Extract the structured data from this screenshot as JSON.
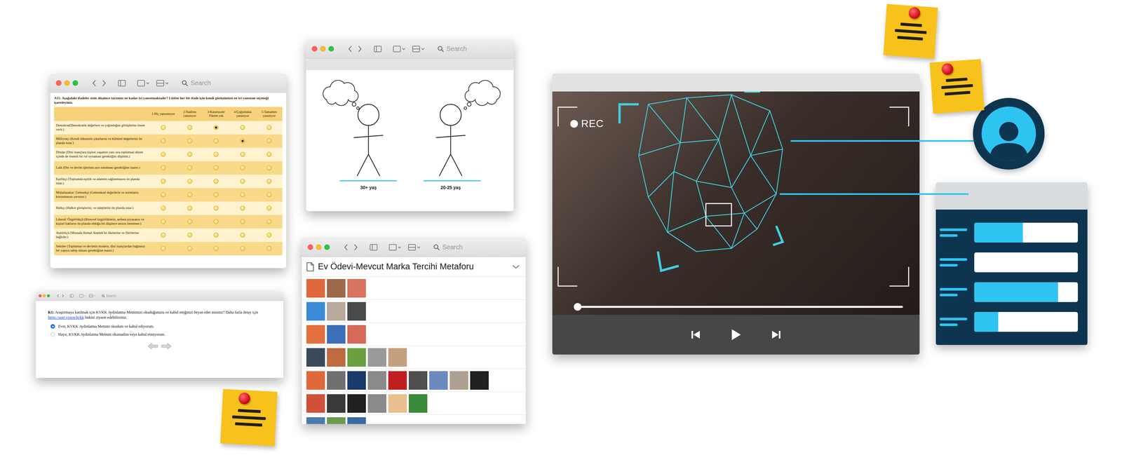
{
  "survey": {
    "search": {
      "placeholder": "Search"
    },
    "question": "A11: Aşağıdaki ifadeler sizin düşünce tarzınızı ne kadar iyi yansıtmaktadır? Lütfen her bir ifade için kendi görüşünüzü en iyi yansıtan seçeneği işaretleyiniz.",
    "columns": [
      "1-Hiç yansıtmıyor",
      "2-Nadiren yansıtıyor",
      "3-Kararsızım/ Fikrim yok",
      "4-Çoğunlukla yansıtıyor",
      "5-Tamamen yansıtıyor"
    ],
    "rows": [
      {
        "label": "Demokrat(Demokratik değerlere ve çoğunluğun görüşlerine önem verir.)",
        "choices": [
          {
            "selected": false
          },
          {
            "selected": false
          },
          {
            "selected": true
          },
          {
            "selected": false
          },
          {
            "selected": false
          }
        ]
      },
      {
        "label": "Milliyetçi (Kendi ülkesinin çıkarlarını ve kültürel değerlerini ön planda tutar.)",
        "choices": [
          {
            "selected": false
          },
          {
            "selected": false
          },
          {
            "selected": false
          },
          {
            "selected": true
          },
          {
            "selected": false
          }
        ]
      },
      {
        "label": "Dindar (Dini inançlara kişisel yaşamın yanı sıra toplumsal düzen içinde de önemli bir rol oynaması gerektiğini düşünür.)",
        "choices": [
          {
            "selected": false
          },
          {
            "selected": false
          },
          {
            "selected": false
          },
          {
            "selected": false
          },
          {
            "selected": false
          }
        ]
      },
      {
        "label": "Laik (Din ve devlet işlerinin ayrı tutulması gerektiğine inanır.)",
        "choices": [
          {
            "selected": false
          },
          {
            "selected": false
          },
          {
            "selected": false
          },
          {
            "selected": false
          },
          {
            "selected": false
          }
        ]
      },
      {
        "label": "Eşitlikçi (Toplumda eşitlik ve adaletin sağlanmasını ön planda tutar.)",
        "choices": [
          {
            "selected": false
          },
          {
            "selected": false
          },
          {
            "selected": false
          },
          {
            "selected": false
          },
          {
            "selected": false
          }
        ]
      },
      {
        "label": "Muhafazakar/ Gelenekçi (Geleneksel değerlerin ve normların korunmasını savunur.)",
        "choices": [
          {
            "selected": false
          },
          {
            "selected": false
          },
          {
            "selected": false
          },
          {
            "selected": false
          },
          {
            "selected": false
          }
        ]
      },
      {
        "label": "Halkçı (Halkın görüşlerini, ve taleplerini ön planda tutar.)",
        "choices": [
          {
            "selected": false
          },
          {
            "selected": false
          },
          {
            "selected": false
          },
          {
            "selected": false
          },
          {
            "selected": false
          }
        ]
      },
      {
        "label": "Liberal/ Özgürlükçü (Bireysel özgürlüklerin, serbest piyasanın ve kişisel hakların ön planda olduğu bir düşünce tarzını benimser.)",
        "choices": [
          {
            "selected": false
          },
          {
            "selected": false
          },
          {
            "selected": false
          },
          {
            "selected": false
          },
          {
            "selected": false
          }
        ]
      },
      {
        "label": "Atatürkçü (Mustafa Kemal Atatürk'ün ilkelerine ve fikirlerine bağlıdır.)",
        "choices": [
          {
            "selected": false
          },
          {
            "selected": false
          },
          {
            "selected": false
          },
          {
            "selected": false
          },
          {
            "selected": false
          }
        ]
      },
      {
        "label": "Seküler (Toplumun ve devletin modern, dini inançlardan bağımsız bir yapıya sahip olması gerektiğine inanır.)",
        "choices": [
          {
            "selected": false
          },
          {
            "selected": false
          },
          {
            "selected": false
          },
          {
            "selected": false
          },
          {
            "selected": false
          }
        ]
      }
    ]
  },
  "figures": {
    "search": {
      "placeholder": "Search"
    },
    "items": [
      {
        "label": "30+ yaş"
      },
      {
        "label": "20-25 yaş"
      }
    ]
  },
  "consent": {
    "search": {
      "placeholder": "Search"
    },
    "label": "K1:",
    "question": "Araştırmaya katılmak için KVKK Aydınlatma Metnimizi okuduğunuzu ve kabul ettiğinizi beyan eder misiniz? Daha fazla detay için",
    "link": "https://user.vision/kvkk",
    "question_tail": "linkini ziyaret edebilirsiniz.",
    "options": [
      {
        "label": "Evet, KVKK Aydınlatma Metnini okudum ve kabul ediyorum.",
        "selected": true
      },
      {
        "label": "Hayır, KVKK Aydınlatma Metnini okumadım veya kabul etmiyorum.",
        "selected": false
      }
    ]
  },
  "photos": {
    "search": {
      "placeholder": "Search"
    },
    "title": "Ev Ödevi-Mevcut Marka Tercihi Metaforu",
    "rows": [
      {
        "thumbnails": [
          {
            "color": "#e0683a"
          },
          {
            "color": "#9c6a4a"
          },
          {
            "color": "#d8735f"
          }
        ]
      },
      {
        "thumbnails": [
          {
            "color": "#3b8ad8"
          },
          {
            "color": "#b9a89c"
          },
          {
            "color": "#4a4a4a"
          }
        ]
      },
      {
        "thumbnails": [
          {
            "color": "#e3703c"
          },
          {
            "color": "#3d6fb8"
          },
          {
            "color": "#d56a5a"
          }
        ]
      },
      {
        "thumbnails": [
          {
            "color": "#3a4a5a"
          },
          {
            "color": "#c06a40"
          },
          {
            "color": "#6aa040"
          },
          {
            "color": "#9a9a9a"
          },
          {
            "color": "#c4a080"
          }
        ]
      },
      {
        "thumbnails": [
          {
            "color": "#e0683a"
          },
          {
            "color": "#707070"
          },
          {
            "color": "#1a3a6a"
          },
          {
            "color": "#8a8a8a"
          },
          {
            "color": "#c02020"
          },
          {
            "color": "#505050"
          },
          {
            "color": "#6a8ac0"
          },
          {
            "color": "#b0a090"
          },
          {
            "color": "#202020"
          }
        ]
      },
      {
        "thumbnails": [
          {
            "color": "#d0503a"
          },
          {
            "color": "#3a3a3a"
          },
          {
            "color": "#202020"
          },
          {
            "color": "#8a8a8a"
          },
          {
            "color": "#e8c090"
          },
          {
            "color": "#3a8a3a"
          }
        ]
      },
      {
        "thumbnails": [
          {
            "color": "#4a7ab0"
          },
          {
            "color": "#6a9a4a"
          },
          {
            "color": "#3a6aa0"
          }
        ]
      }
    ]
  },
  "video": {
    "rec_label": "REC",
    "progress": {
      "level": 0.01
    }
  },
  "bar_card": {
    "bars": [
      {
        "level": 0.47
      },
      {
        "level": 0.0
      },
      {
        "level": 0.81
      },
      {
        "level": 0.23
      }
    ]
  }
}
